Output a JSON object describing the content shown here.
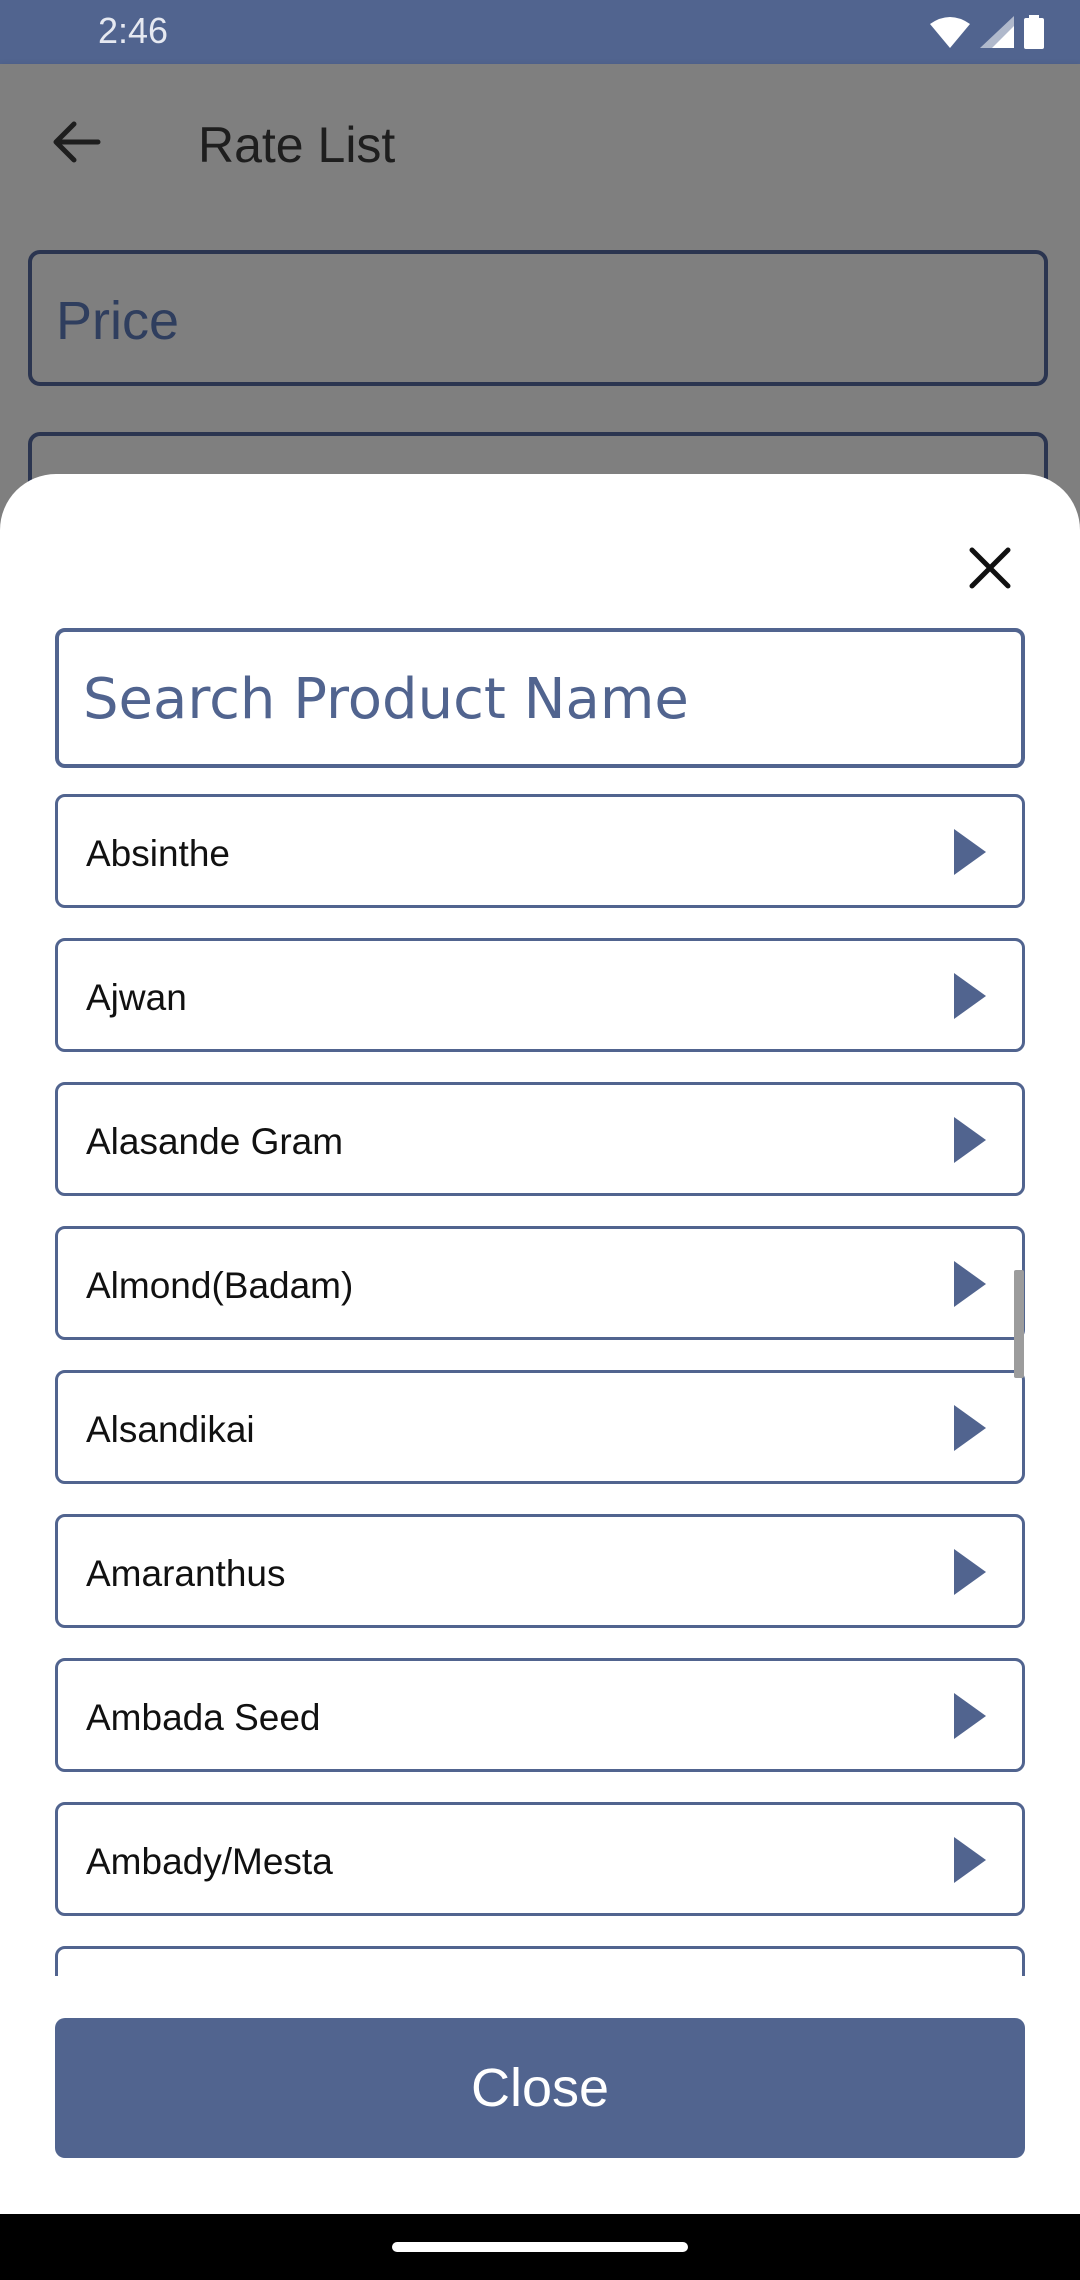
{
  "status_bar": {
    "time": "2:46"
  },
  "header": {
    "title": "Rate List"
  },
  "background_form": {
    "price_label": "Price"
  },
  "sheet": {
    "search_placeholder": "Search Product Name",
    "items": [
      {
        "label": "Absinthe"
      },
      {
        "label": "Ajwan"
      },
      {
        "label": "Alasande Gram"
      },
      {
        "label": "Almond(Badam)"
      },
      {
        "label": "Alsandikai"
      },
      {
        "label": "Amaranthus"
      },
      {
        "label": "Ambada Seed"
      },
      {
        "label": "Ambady/Mesta"
      }
    ],
    "close_label": "Close"
  },
  "colors": {
    "accent": "#51648f",
    "scrim": "#7f7f7f"
  },
  "icons": [
    "back-arrow-icon",
    "close-icon",
    "play-icon",
    "wifi-icon",
    "signal-icon",
    "battery-icon"
  ]
}
